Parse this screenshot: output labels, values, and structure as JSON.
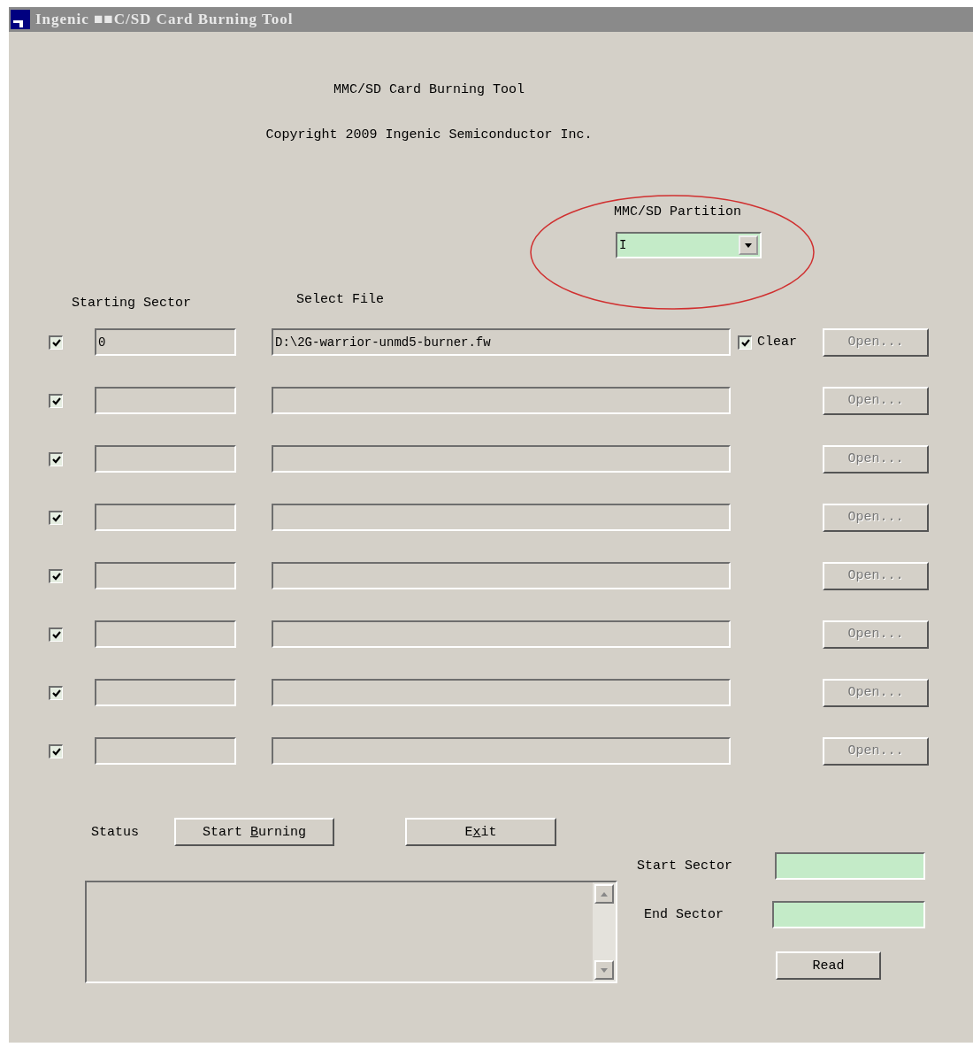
{
  "window": {
    "title": "Ingenic ■■C/SD Card Burning Tool"
  },
  "heading": "MMC/SD Card Burning Tool",
  "copyright": "Copyright 2009 Ingenic Semiconductor Inc.",
  "partition": {
    "label": "MMC/SD Partition",
    "value": "I",
    "highlighted": true
  },
  "columns": {
    "sector": "Starting Sector",
    "file": "Select File"
  },
  "rows": [
    {
      "checked": true,
      "sector": "0",
      "file": "D:\\2G-warrior-unmd5-burner.fw",
      "clear": {
        "label": "Clear",
        "checked": true
      },
      "open_button": {
        "label": "Open...",
        "disabled": true
      }
    },
    {
      "checked": true,
      "open_button": {
        "label": "Open...",
        "disabled": true
      }
    },
    {
      "checked": true,
      "open_button": {
        "label": "Open...",
        "disabled": true
      }
    },
    {
      "checked": true,
      "open_button": {
        "label": "Open...",
        "disabled": true
      }
    },
    {
      "checked": true,
      "open_button": {
        "label": "Open...",
        "disabled": true
      }
    },
    {
      "checked": true,
      "open_button": {
        "label": "Open...",
        "disabled": true
      }
    },
    {
      "checked": true,
      "open_button": {
        "label": "Open...",
        "disabled": true
      }
    },
    {
      "checked": true,
      "open_button": {
        "label": "Open...",
        "disabled": true
      }
    }
  ],
  "status_label": "Status",
  "buttons": [
    {
      "kind": "start",
      "before": "Start ",
      "mnemonic": "B",
      "after": "urning"
    },
    {
      "kind": "exit",
      "before": "E",
      "mnemonic": "x",
      "after": "it"
    }
  ],
  "read_panel": {
    "start_label": "Start Sector",
    "end_label": "End Sector",
    "read_button": "Read"
  }
}
